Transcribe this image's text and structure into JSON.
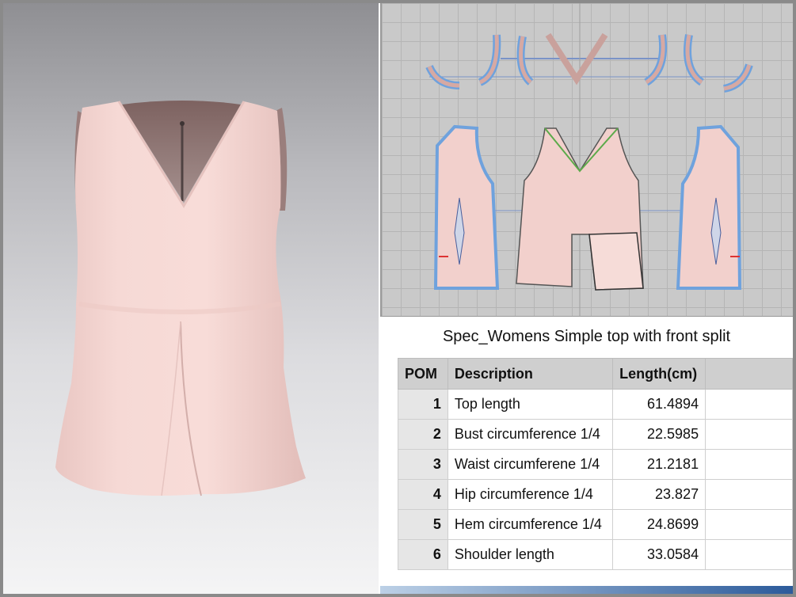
{
  "spec": {
    "title": "Spec_Womens Simple top with front split",
    "headers": [
      "POM",
      "Description",
      "Length(cm)",
      ""
    ],
    "rows": [
      {
        "pom": "1",
        "description": "Top length",
        "length": "61.4894"
      },
      {
        "pom": "2",
        "description": "Bust circumference 1/4",
        "length": "22.5985"
      },
      {
        "pom": "3",
        "description": "Waist circumferene 1/4",
        "length": "21.2181"
      },
      {
        "pom": "4",
        "description": "Hip circumference 1/4",
        "length": "23.827"
      },
      {
        "pom": "5",
        "description": "Hem circumference 1/4",
        "length": "24.8699"
      },
      {
        "pom": "6",
        "description": "Shoulder length",
        "length": "33.0584"
      }
    ]
  },
  "colors": {
    "fabric": "#f4d4d0",
    "lining": "#8e7270",
    "pattern_fill": "#f2d0cc",
    "seam_blue": "#6fa2dd",
    "seam_green": "#5caa4a",
    "grid_bg": "#c9c9c9"
  },
  "icons": [
    "garment-3d-render",
    "pattern-pieces"
  ]
}
